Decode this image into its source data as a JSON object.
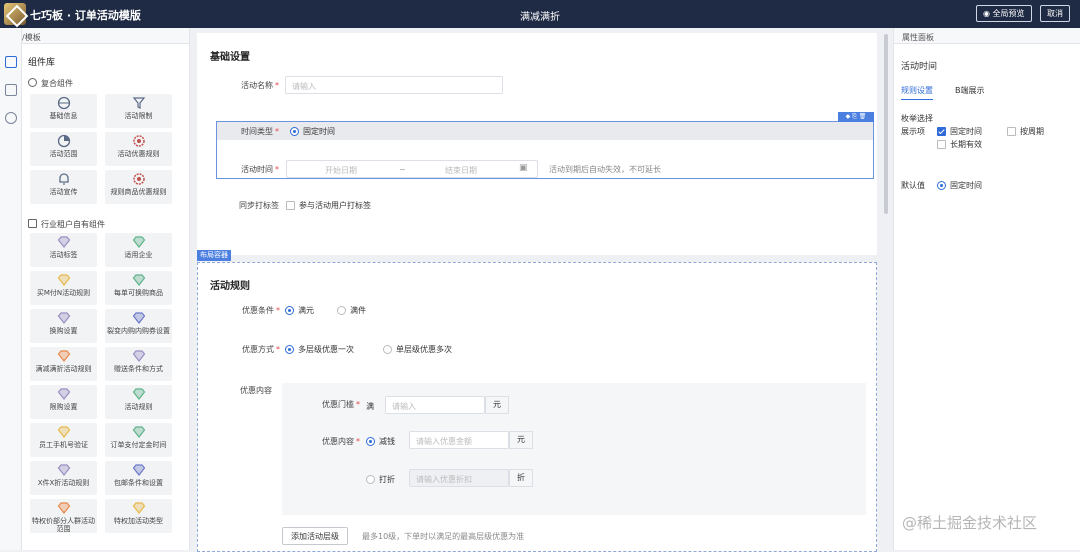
{
  "app": {
    "title": "七巧板 · 订单活动模版",
    "page_title": "满减满折",
    "preview_label": "全局预览",
    "cancel_label": "取消"
  },
  "left_panel": {
    "header": "组件/模板",
    "tab": "组件库",
    "group1": {
      "title": "复合组件",
      "items": [
        "基础信息",
        "活动限制",
        "活动范围",
        "活动优惠规则",
        "活动宣传",
        "规则商品优惠规则"
      ]
    },
    "group2": {
      "title": "行业租户自有组件",
      "items": [
        "活动标签",
        "适用企业",
        "买M付N活动规则",
        "每单可换购商品",
        "换购设置",
        "裂变内购内购券设置",
        "满减满折活动规则",
        "赠送条件和方式",
        "限购设置",
        "活动规则",
        "员工手机号验证",
        "订单支付定金时间",
        "X件X折活动规则",
        "包邮条件和设置",
        "特权价部分人群活动范围",
        "特权加活动类型"
      ]
    }
  },
  "basic": {
    "title": "基础设置",
    "name_label": "活动名称",
    "name_placeholder": "请输入",
    "time_type_label": "时间类型",
    "time_type_option": "固定时间",
    "time_label": "活动时间",
    "start_placeholder": "开始日期",
    "range_sep": "~",
    "end_placeholder": "结束日期",
    "time_hint": "活动到期后自动失效，不可延长",
    "sync_label": "同步打标签",
    "sync_option": "参与活动用户打标签",
    "toolbar": "◆ ⎘ 🗑"
  },
  "layout_tag": "布局容器",
  "rules": {
    "title": "活动规则",
    "condition_label": "优惠条件",
    "condition_options": [
      "满元",
      "满件"
    ],
    "mode_label": "优惠方式",
    "mode_options": [
      "多层级优惠一次",
      "单层级优惠多次"
    ],
    "content_label": "优惠内容",
    "threshold_label": "优惠门槛",
    "threshold_prefix": "满",
    "threshold_placeholder": "请输入",
    "threshold_unit": "元",
    "detail_label": "优惠内容",
    "reduce_option": "减钱",
    "reduce_placeholder": "请输入优惠金额",
    "reduce_unit": "元",
    "discount_option": "打折",
    "discount_placeholder": "请输入优惠折扣",
    "discount_unit": "折",
    "add_level_button": "添加活动层级",
    "add_level_hint": "最多10级，下单时以满足的最高层级优惠为准"
  },
  "right_panel": {
    "header": "属性面板",
    "field_title": "活动时间",
    "tabs": [
      "规则设置",
      "B端展示"
    ],
    "enum_label": "枚举选择",
    "show_label": "展示项",
    "show_options": [
      "固定时间",
      "按周期",
      "长期有效"
    ],
    "default_label": "默认值",
    "default_option": "固定时间"
  },
  "watermark": "@稀土掘金技术社区",
  "colors": {
    "topbar": "#1f2a44",
    "accent": "#2f6bd8",
    "required": "#e5484d"
  }
}
